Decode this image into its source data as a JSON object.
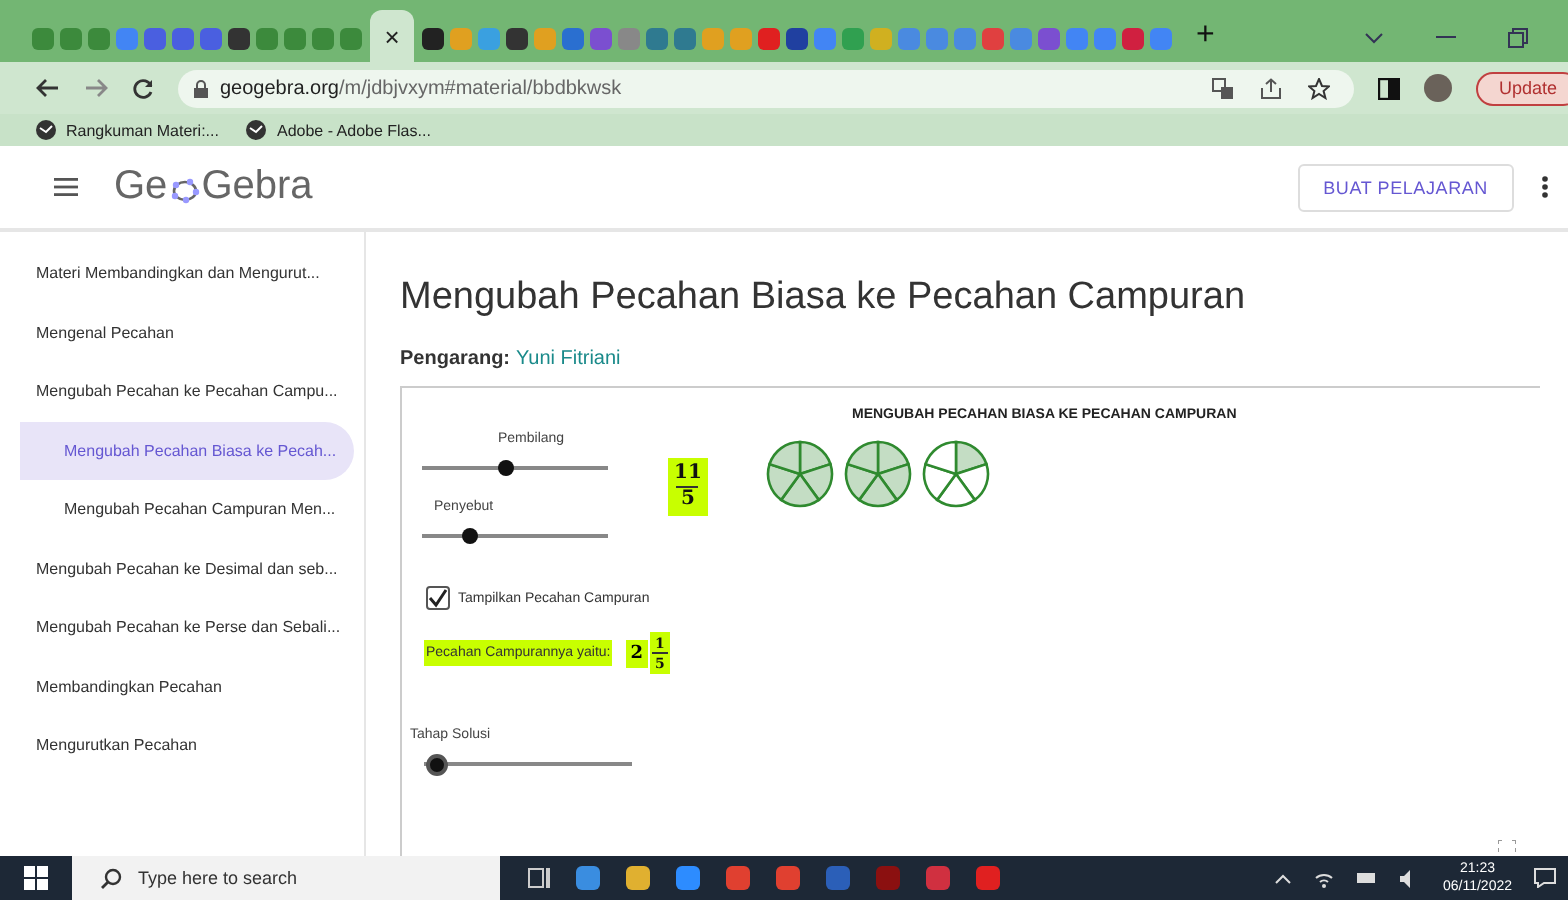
{
  "browser": {
    "close_tab": "×",
    "new_tab": "+",
    "url_host": "geogebra.org",
    "url_path": "/m/jdbjvxym#material/bbdbkwsk",
    "update": "Update",
    "bookmarks": [
      "Rangkuman Materi:...",
      "Adobe - Adobe Flas..."
    ]
  },
  "header": {
    "logo_left": "Ge",
    "logo_right": "Gebra",
    "button": "BUAT PELAJARAN"
  },
  "sidebar": {
    "items": [
      {
        "label": "Materi Membandingkan dan Mengurut...",
        "selected": false
      },
      {
        "label": "Mengenal Pecahan",
        "selected": false
      },
      {
        "label": "Mengubah Pecahan ke Pecahan Campu...",
        "selected": false,
        "children": [
          {
            "label": "Mengubah Pecahan Biasa ke Pecah...",
            "selected": true
          },
          {
            "label": "Mengubah Pecahan Campuran Men...",
            "selected": false
          }
        ]
      },
      {
        "label": "Mengubah Pecahan ke Desimal dan seb...",
        "selected": false
      },
      {
        "label": "Mengubah Pecahan ke Perse dan Sebali...",
        "selected": false
      },
      {
        "label": "Membandingkan Pecahan",
        "selected": false
      },
      {
        "label": "Mengurutkan Pecahan",
        "selected": false
      }
    ]
  },
  "page": {
    "title": "Mengubah Pecahan Biasa ke Pecahan Campuran",
    "author_label": "Pengarang:",
    "author": "Yuni Fitriani"
  },
  "applet": {
    "heading": "MENGUBAH PECAHAN BIASA KE PECAHAN CAMPURAN",
    "sliders": [
      {
        "label": "Pembilang",
        "level": 0.44
      },
      {
        "label": "Penyebut",
        "level": 0.22
      },
      {
        "label": "Tahap Solusi",
        "level": 0
      }
    ],
    "fraction": {
      "numerator": "11",
      "denominator": "5"
    },
    "pies": [
      {
        "slices": [
          {
            "shaded": true
          },
          {
            "shaded": true
          },
          {
            "shaded": true
          },
          {
            "shaded": true
          },
          {
            "shaded": true
          }
        ]
      },
      {
        "slices": [
          {
            "shaded": true
          },
          {
            "shaded": true
          },
          {
            "shaded": true
          },
          {
            "shaded": true
          },
          {
            "shaded": true
          }
        ]
      },
      {
        "slices": [
          {
            "shaded": true
          },
          {
            "shaded": false
          },
          {
            "shaded": false
          },
          {
            "shaded": false
          },
          {
            "shaded": false
          }
        ]
      }
    ],
    "checkbox": {
      "label": "Tampilkan Pecahan Campuran",
      "checked": true
    },
    "mixed": {
      "label": "Pecahan Campurannya yaitu:",
      "whole": "2",
      "numerator": "1",
      "denominator": "5"
    }
  },
  "taskbar": {
    "search_placeholder": "Type here to search",
    "time": "21:23",
    "date": "06/11/2022"
  }
}
